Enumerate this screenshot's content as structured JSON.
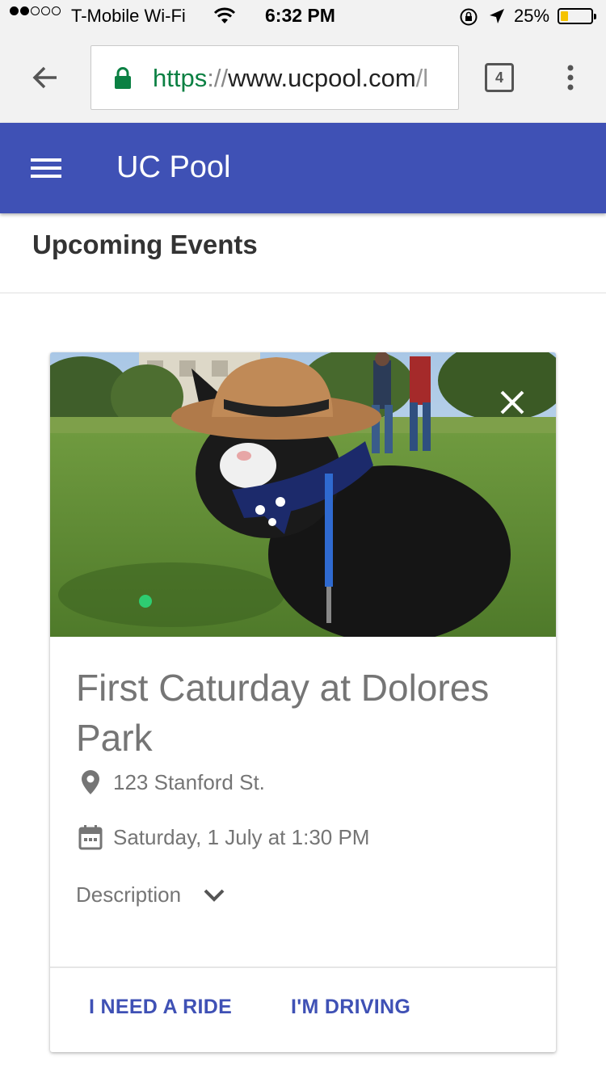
{
  "status_bar": {
    "carrier": "T-Mobile Wi-Fi",
    "time": "6:32 PM",
    "battery_percent": "25%",
    "battery_level": 0.25,
    "signal_dots_filled": 2,
    "signal_dots_total": 5
  },
  "browser": {
    "url_scheme": "https",
    "url_separator": "://",
    "url_host": "www.ucpool.com",
    "url_rest": "/l",
    "tab_count": "4"
  },
  "app_bar": {
    "title": "UC Pool",
    "color": "#3f51b5"
  },
  "page": {
    "section_title": "Upcoming Events"
  },
  "event": {
    "title": "First Caturday at Dolores Park",
    "location": "123 Stanford St.",
    "datetime": "Saturday, 1 July at 1:30 PM",
    "description_label": "Description",
    "ride_button": "I NEED A RIDE",
    "drive_button": "I'M DRIVING"
  },
  "icons": {
    "back": "arrow-left",
    "secure": "padlock",
    "tabs": "tab-counter",
    "overflow": "three-dots-vertical",
    "menu": "hamburger",
    "close": "x",
    "location": "map-pin",
    "calendar": "calendar",
    "expand": "chevron-down"
  }
}
